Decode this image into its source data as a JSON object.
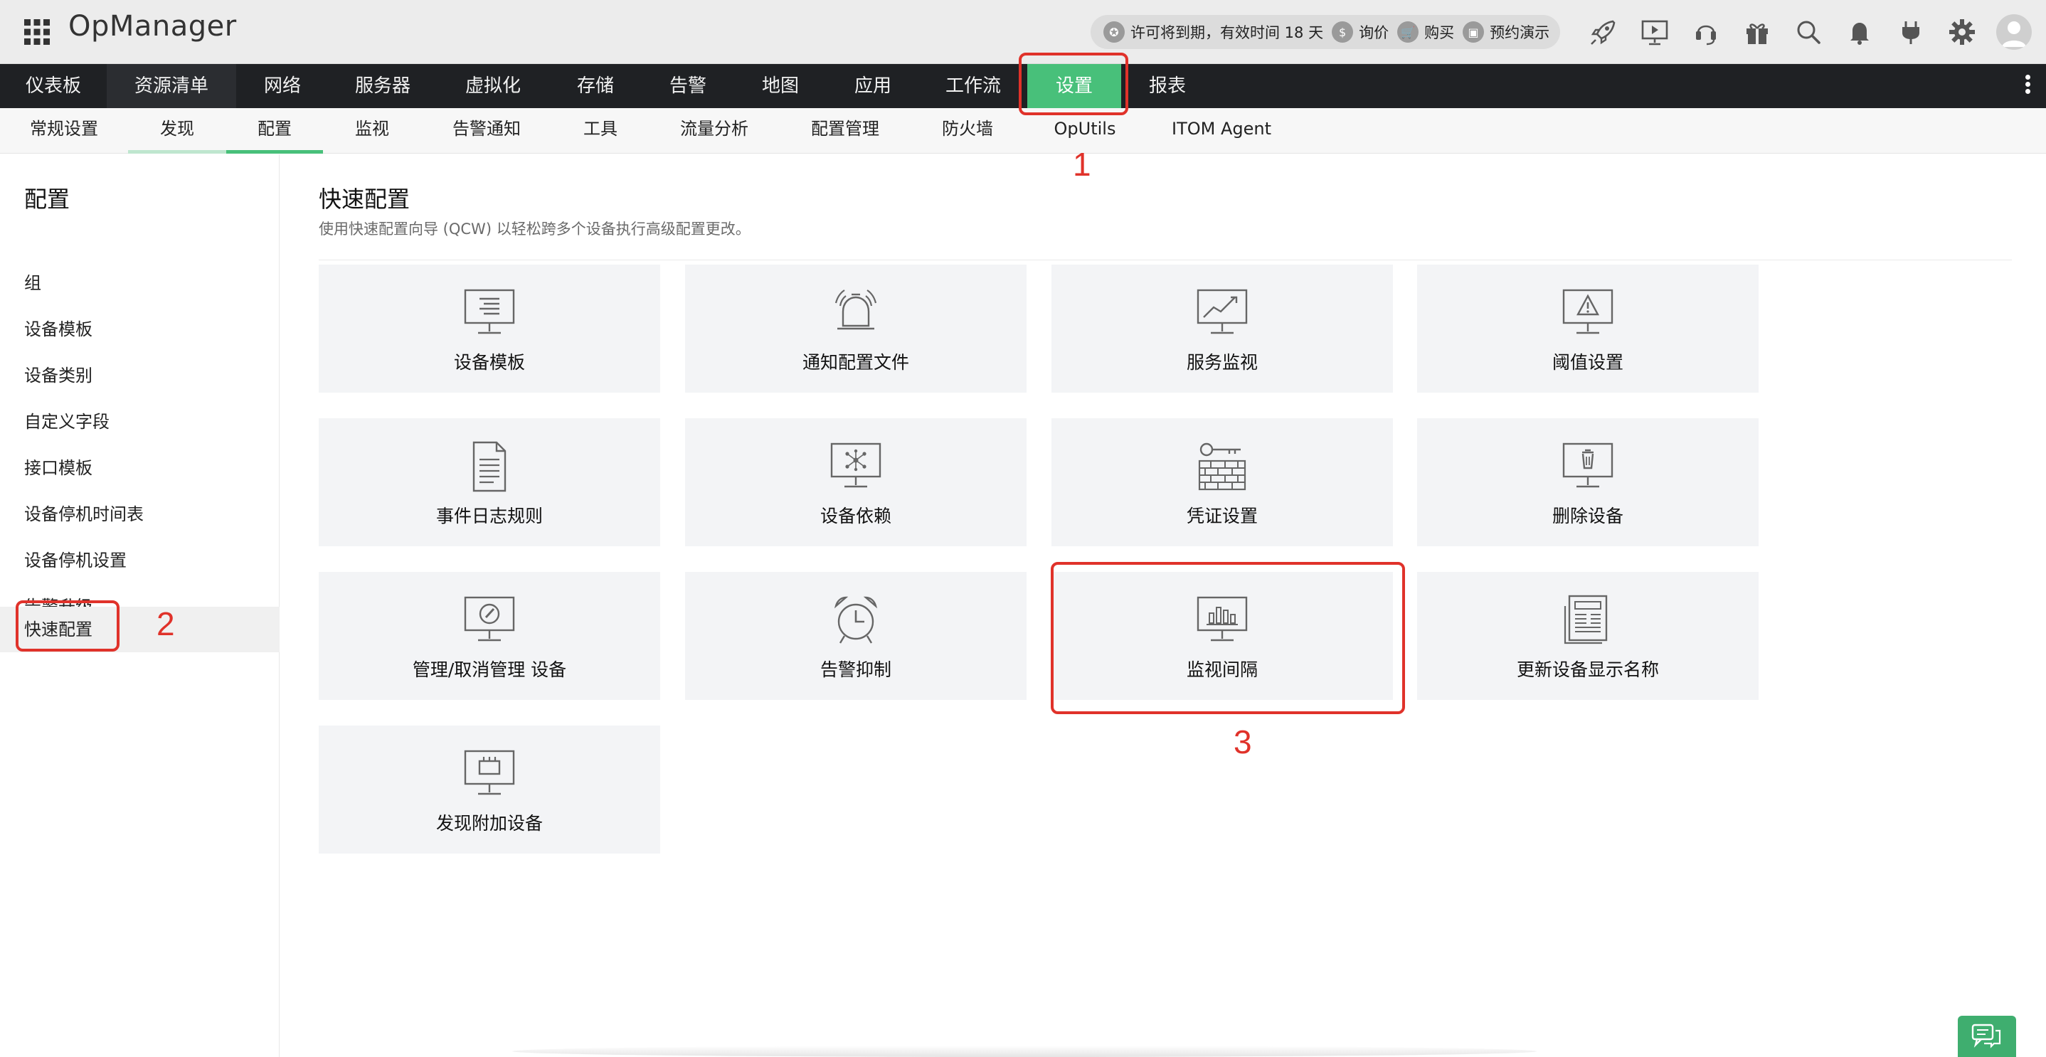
{
  "header": {
    "app_title": "OpManager",
    "apps_icon": "grid-apps-icon",
    "license_text": "许可将到期，有效时间 18 天",
    "inquire_label": "询价",
    "buy_label": "购买",
    "demo_label": "预约演示",
    "icons": [
      "rocket-icon",
      "presentation-icon",
      "support-headset-icon",
      "gift-icon",
      "search-icon",
      "bell-icon",
      "plug-icon",
      "gear-icon",
      "user-avatar-icon"
    ]
  },
  "main_nav": {
    "items": [
      "仪表板",
      "资源清单",
      "网络",
      "服务器",
      "虚拟化",
      "存储",
      "告警",
      "地图",
      "应用",
      "工作流",
      "设置",
      "报表"
    ],
    "active": "设置",
    "active_color": "#48c07a"
  },
  "sub_nav": {
    "items": [
      "常规设置",
      "发现",
      "配置",
      "监视",
      "告警通知",
      "工具",
      "流量分析",
      "配置管理",
      "防火墙",
      "OpUtils",
      "ITOM Agent"
    ],
    "active": "配置"
  },
  "sidebar": {
    "title": "配置",
    "items": [
      "组",
      "设备模板",
      "设备类别",
      "自定义字段",
      "接口模板",
      "设备停机时间表",
      "设备停机设置",
      "告警升级",
      "快速配置"
    ],
    "active": "快速配置"
  },
  "content": {
    "title": "快速配置",
    "subtitle": "使用快速配置向导 (QCW) 以轻松跨多个设备执行高级配置更改。",
    "cards": [
      {
        "label": "设备模板",
        "icon": "monitor-list-icon"
      },
      {
        "label": "通知配置文件",
        "icon": "alarm-bell-icon"
      },
      {
        "label": "服务监视",
        "icon": "monitor-chart-icon"
      },
      {
        "label": "阈值设置",
        "icon": "monitor-warning-icon"
      },
      {
        "label": "事件日志规则",
        "icon": "document-icon"
      },
      {
        "label": "设备依赖",
        "icon": "monitor-network-icon"
      },
      {
        "label": "凭证设置",
        "icon": "key-wall-icon"
      },
      {
        "label": "删除设备",
        "icon": "monitor-trash-icon"
      },
      {
        "label": "管理/取消管理 设备",
        "icon": "monitor-gauge-icon"
      },
      {
        "label": "告警抑制",
        "icon": "alarm-clock-icon"
      },
      {
        "label": "监视间隔",
        "icon": "monitor-bars-icon"
      },
      {
        "label": "更新设备显示名称",
        "icon": "newspaper-icon"
      },
      {
        "label": "发现附加设备",
        "icon": "monitor-device-icon"
      }
    ]
  },
  "annotations": {
    "color": "#e0322a",
    "labels": [
      "1",
      "2",
      "3"
    ]
  },
  "chat_icon": "chat-bubbles-icon"
}
